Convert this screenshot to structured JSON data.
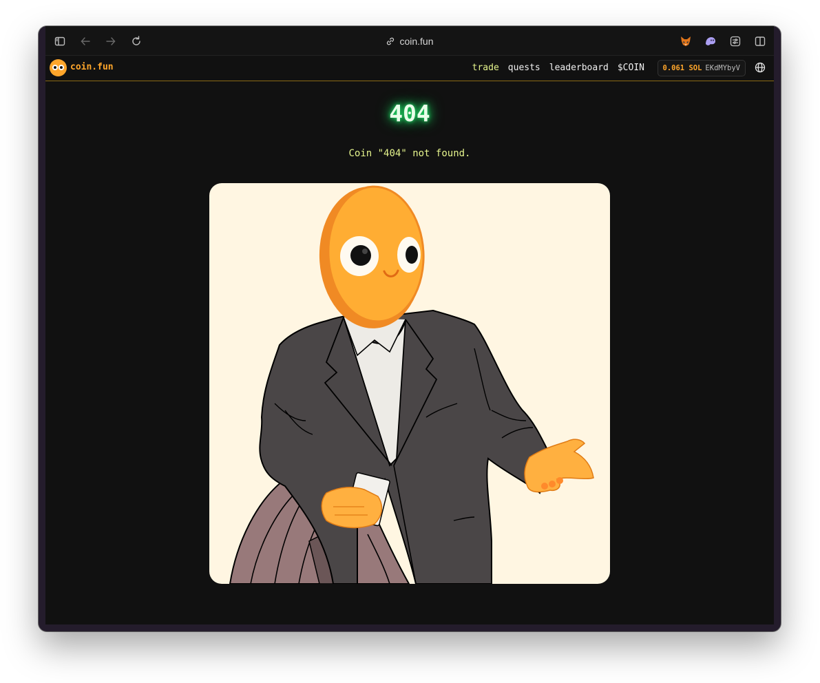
{
  "browser": {
    "url": "coin.fun",
    "icons": {
      "sidebar": "sidebar-icon",
      "back": "back-arrow-icon",
      "forward": "forward-arrow-icon",
      "reload": "reload-icon",
      "link": "link-icon",
      "ext1": "fox-extension-icon",
      "ext2": "ghost-extension-icon",
      "ext3": "extensions-icon",
      "split": "split-view-icon"
    }
  },
  "nav": {
    "logo_text": "coin.fun",
    "links": [
      {
        "label": "trade",
        "active": true
      },
      {
        "label": "quests",
        "active": false
      },
      {
        "label": "leaderboard",
        "active": false
      },
      {
        "label": "$COIN",
        "active": false
      }
    ],
    "wallet": {
      "balance": "0.061 SOL",
      "address": "EKdMYbyV"
    },
    "globe_icon": "globe-icon"
  },
  "error": {
    "code": "404",
    "message": "Coin \"404\" not found."
  },
  "illustration": {
    "icon": "coin-mascot-illustration"
  },
  "colors": {
    "accent_orange": "#ffa62b",
    "accent_yellow": "#e6f58d",
    "glow_green": "#22e06a",
    "card_bg": "#fff6e2"
  }
}
